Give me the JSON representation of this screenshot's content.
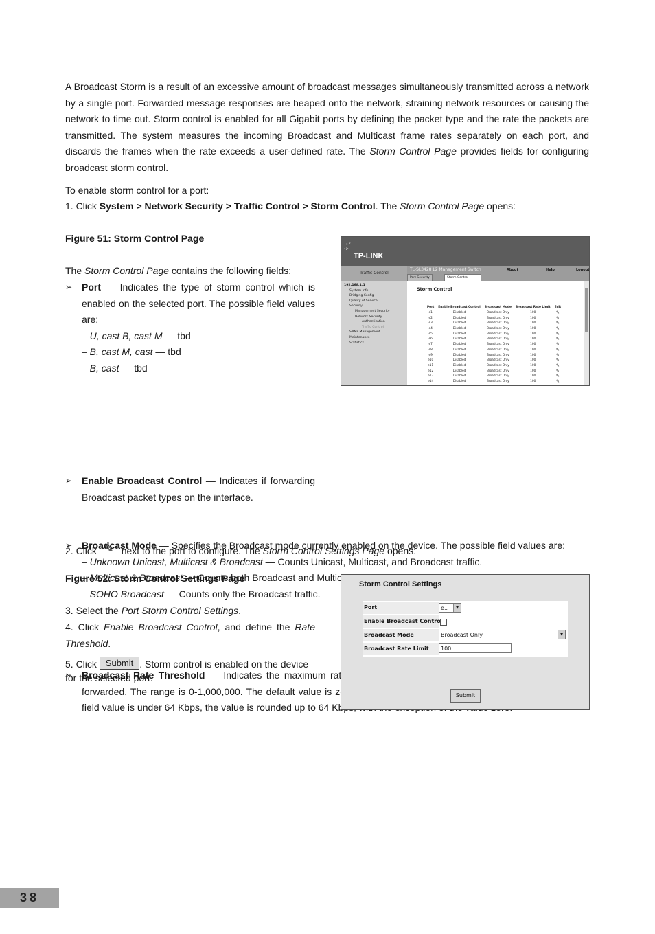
{
  "intro": [
    [
      "",
      "A Broadcast Storm is a result of an excessive amount of broadcast messages simultaneously transmitted across a network by a single port. Forwarded message responses are heaped onto the network, straining network resources or causing the network to time out. Storm control is enabled for all Gigabit ports by defining the packet type and the rate the packets are transmitted. The system measures the incoming Broadcast and Multicast frame rates separately on each port, and discards the frames when the rate exceeds a user-defined rate. The "
    ],
    [
      "i",
      "Storm Control Page"
    ],
    [
      "",
      " provides fields for configuring broadcast storm control."
    ]
  ],
  "enable_intro": [
    [
      "",
      "To enable storm control for a port:"
    ]
  ],
  "step1": [
    [
      "",
      "1.   Click "
    ],
    [
      "b",
      "System > Network Security > Traffic Control > Storm Control"
    ],
    [
      "",
      ". The "
    ],
    [
      "i",
      "Storm Control Page"
    ],
    [
      "",
      " opens:"
    ]
  ],
  "fig51_caption": [
    [
      "b",
      "Figure 51: Storm Control Page"
    ]
  ],
  "fields_intro": [
    [
      "",
      "The "
    ],
    [
      "i",
      "Storm Control Page"
    ],
    [
      "",
      " contains the following fields:"
    ]
  ],
  "port_field": [
    [
      "b",
      "Port"
    ],
    [
      "",
      " — Indicates the type of storm control which is enabled on the selected port. The possible field values are:"
    ]
  ],
  "port_values": [
    [
      [
        "i",
        "– U, cast B, cast M"
      ],
      [
        "",
        " — tbd"
      ]
    ],
    [
      [
        "i",
        "– B, cast M, cast"
      ],
      [
        "",
        " — tbd"
      ]
    ],
    [
      [
        "i",
        "– B, cast"
      ],
      [
        "",
        " — tbd"
      ]
    ]
  ],
  "ebc_field": [
    [
      "b",
      "Enable Broadcast Control"
    ],
    [
      "",
      " — Indicates if forwarding Broadcast packet types on the interface."
    ]
  ],
  "mode_field": [
    [
      "b",
      "Broadcast Mode"
    ],
    [
      "",
      " — Specifies the Broadcast mode currently enabled on the device. The possible field values are:"
    ]
  ],
  "mode_values": [
    [
      [
        "i",
        "– Unknown Unicast, Multicast & Broadcast"
      ],
      [
        "",
        " — Counts Unicast, Multicast, and Broadcast traffic."
      ]
    ],
    [
      [
        "i",
        "– Multicast & Broadcast"
      ],
      [
        "",
        " — Counts both Broadcast and Multicast traffic together."
      ]
    ],
    [
      [
        "i",
        "– SOHO Broadcast"
      ],
      [
        "",
        " — Counts only the Broadcast traffic."
      ]
    ]
  ],
  "rate_field": [
    [
      "b",
      "Broadcast Rate Threshold"
    ],
    [
      "",
      " — Indicates the maximum rate (kilobytes per second) at which unknown packets are forwarded. The range is 0-1,000,000. The default value is zero. All values are rounded to the nearest 64 Kbps. If the field value is under 64 Kbps, the value is rounded up to 64 Kbps, with the exception of the value zero."
    ]
  ],
  "step2": {
    "prefix": "2.   Click",
    "suffix_segments": [
      [
        "",
        "next to the port to configure. The "
      ],
      [
        "i",
        "Storm Control Settings Page"
      ],
      [
        "",
        " opens:"
      ]
    ]
  },
  "fig52_caption": [
    [
      "b",
      "Figure 52: Storm Control Settings Page"
    ]
  ],
  "step3": [
    [
      "",
      "3.   Select the "
    ],
    [
      "i",
      "Port Storm Control Settings"
    ],
    [
      "",
      "."
    ]
  ],
  "step4": [
    [
      "",
      "4.   Click "
    ],
    [
      "i",
      "Enable Broadcast Control"
    ],
    [
      "",
      ", and define the "
    ],
    [
      "i",
      "Rate Threshold"
    ],
    [
      "",
      "."
    ]
  ],
  "step5": {
    "prefix": "5.   Click",
    "button": "Submit",
    "suffix": ". Storm control is enabled on the device for the selected port."
  },
  "bullet_glyph": "➢",
  "fig51": {
    "logo": "TP-LINK",
    "section_title": "Traffic Control",
    "product": "TL-SL3428 L2 Management Switch",
    "links": [
      "About",
      "Help",
      "Logout"
    ],
    "tabs": [
      "Port Security",
      "Storm Control"
    ],
    "tree": [
      "192.168.1.1",
      "System Info",
      "Bridging Config",
      "Quality of Service",
      "Security",
      "Management Security",
      "Network Security",
      "Authentication",
      "Traffic Control",
      "SNMP Management",
      "Maintenance",
      "Statistics"
    ],
    "title": "Storm Control",
    "columns": [
      "Port",
      "Enable Broadcast Control",
      "Broadcast Mode",
      "Broadcast Rate Limit",
      "Edit"
    ],
    "rows": [
      [
        "e1",
        "Disabled",
        "Broadcast Only",
        "100"
      ],
      [
        "e2",
        "Disabled",
        "Broadcast Only",
        "100"
      ],
      [
        "e3",
        "Disabled",
        "Broadcast Only",
        "100"
      ],
      [
        "e4",
        "Disabled",
        "Broadcast Only",
        "100"
      ],
      [
        "e5",
        "Disabled",
        "Broadcast Only",
        "100"
      ],
      [
        "e6",
        "Disabled",
        "Broadcast Only",
        "100"
      ],
      [
        "e7",
        "Disabled",
        "Broadcast Only",
        "100"
      ],
      [
        "e8",
        "Disabled",
        "Broadcast Only",
        "100"
      ],
      [
        "e9",
        "Disabled",
        "Broadcast Only",
        "100"
      ],
      [
        "e10",
        "Disabled",
        "Broadcast Only",
        "100"
      ],
      [
        "e11",
        "Disabled",
        "Broadcast Only",
        "100"
      ],
      [
        "e12",
        "Disabled",
        "Broadcast Only",
        "100"
      ],
      [
        "e13",
        "Disabled",
        "Broadcast Only",
        "100"
      ],
      [
        "e14",
        "Disabled",
        "Broadcast Only",
        "100"
      ]
    ],
    "edit_icon": "pencil-icon"
  },
  "fig52": {
    "title": "Storm Control Settings",
    "port_label": "Port",
    "port_value": "e1",
    "ebc_label": "Enable Broadcast Control",
    "ebc_checked": false,
    "mode_label": "Broadcast Mode",
    "mode_value": "Broadcast Only",
    "rate_label": "Broadcast Rate Limit",
    "rate_value": "100",
    "submit": "Submit"
  },
  "page_number": "38"
}
